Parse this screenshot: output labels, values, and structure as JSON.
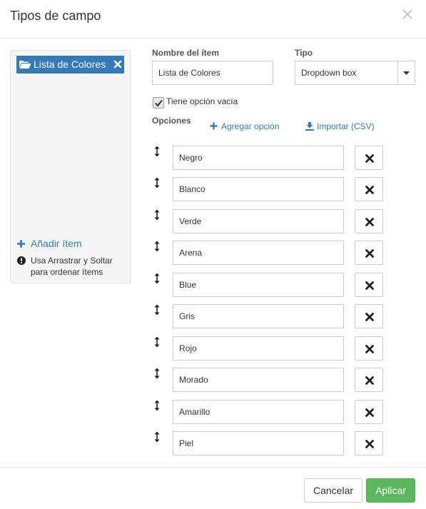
{
  "dialog": {
    "title": "Tipos de campo",
    "close_icon": "close-icon"
  },
  "sidebar": {
    "selected_item": "Lista de Colores",
    "add_item_label": "Añadir ítem",
    "hint": "Usa Arrastrar y Soltar para ordenar ítems"
  },
  "form": {
    "name_label": "Nombre del ítem",
    "name_value": "Lista de Colores",
    "type_label": "Tipo",
    "type_value": "Dropdown box",
    "empty_option_label": "Tiene opción vacía",
    "empty_option_checked": true,
    "options_label": "Opciones",
    "add_option_label": "Agregar opción",
    "import_label": "Importar (CSV)",
    "options": [
      "Negro",
      "Blanco",
      "Verde",
      "Arena",
      "Blue",
      "Gris",
      "Rojo",
      "Morado",
      "Amarillo",
      "Piel"
    ]
  },
  "footer": {
    "cancel_label": "Cancelar",
    "apply_label": "Aplicar"
  },
  "colors": {
    "primary": "#337ab7",
    "success": "#5cb85c",
    "sidebar_bg": "#f5f5f5"
  }
}
